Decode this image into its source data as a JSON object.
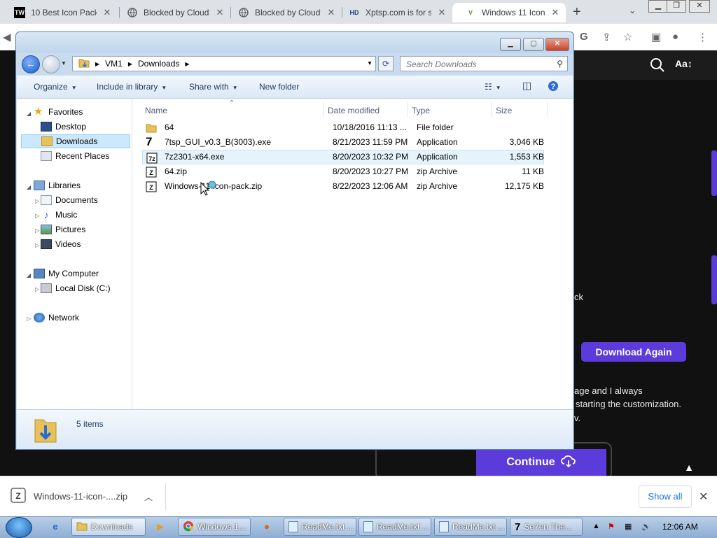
{
  "browser": {
    "tabs": [
      {
        "favicon": "TW",
        "title": "10 Best Icon Packs"
      },
      {
        "favicon": "globe",
        "title": "Blocked by Cloudf"
      },
      {
        "favicon": "globe",
        "title": "Blocked by Cloudf"
      },
      {
        "favicon": "HD",
        "title": "Xptsp.com is for sa"
      },
      {
        "favicon": "V",
        "title": "Windows 11 Icon"
      }
    ],
    "new_tab": "+"
  },
  "website": {
    "aa_label": "Aa↕",
    "partial_text_1": "ck",
    "download_again": "Download Again",
    "partial_text_2": "age and I always",
    "partial_text_3": "starting the customization.",
    "partial_text_4": "v.",
    "continue_label": "Continue"
  },
  "explorer": {
    "breadcrumb": [
      "VM1",
      "Downloads"
    ],
    "search_placeholder": "Search Downloads",
    "commands": {
      "organize": "Organize",
      "include_in_library": "Include in library",
      "share_with": "Share with",
      "new_folder": "New folder"
    },
    "nav": {
      "favorites": "Favorites",
      "desktop": "Desktop",
      "downloads": "Downloads",
      "recent_places": "Recent Places",
      "libraries": "Libraries",
      "documents": "Documents",
      "music": "Music",
      "pictures": "Pictures",
      "videos": "Videos",
      "my_computer": "My Computer",
      "local_disk": "Local Disk (C:)",
      "network": "Network"
    },
    "columns": {
      "name": "Name",
      "date": "Date modified",
      "type": "Type",
      "size": "Size"
    },
    "files": [
      {
        "icon": "folder-icon",
        "name": "64",
        "date": "10/18/2016 11:13 ...",
        "type": "File folder",
        "size": ""
      },
      {
        "icon": "seven-tsp-icon",
        "name": "7tsp_GUI_v0.3_B(3003).exe",
        "date": "8/21/2023 11:59 PM",
        "type": "Application",
        "size": "3,046 KB"
      },
      {
        "icon": "7zip-icon",
        "name": "7z2301-x64.exe",
        "date": "8/20/2023 10:32 PM",
        "type": "Application",
        "size": "1,553 KB"
      },
      {
        "icon": "zip-icon",
        "name": "64.zip",
        "date": "8/20/2023 10:27 PM",
        "type": "zip Archive",
        "size": "11 KB"
      },
      {
        "icon": "zip-icon",
        "name": "Windows-11-icon-pack.zip",
        "date": "8/22/2023 12:06 AM",
        "type": "zip Archive",
        "size": "12,175 KB"
      }
    ],
    "status": "5 items"
  },
  "download_bar": {
    "file": "Windows-11-icon-....zip",
    "show_all": "Show all"
  },
  "taskbar": {
    "buttons": [
      {
        "label": "Downloads"
      },
      {
        "label": "Windows 1..."
      },
      {
        "label": "ReadMe.txt ..."
      },
      {
        "label": "ReadMe.txt ..."
      },
      {
        "label": "ReadMe.txt ..."
      },
      {
        "label": "Se7en The..."
      }
    ],
    "clock": "12:06 AM"
  },
  "colors": {
    "accent_purple": "#5b3bd9",
    "selection_blue": "#cce8ff",
    "chrome_link": "#1a73e8"
  }
}
